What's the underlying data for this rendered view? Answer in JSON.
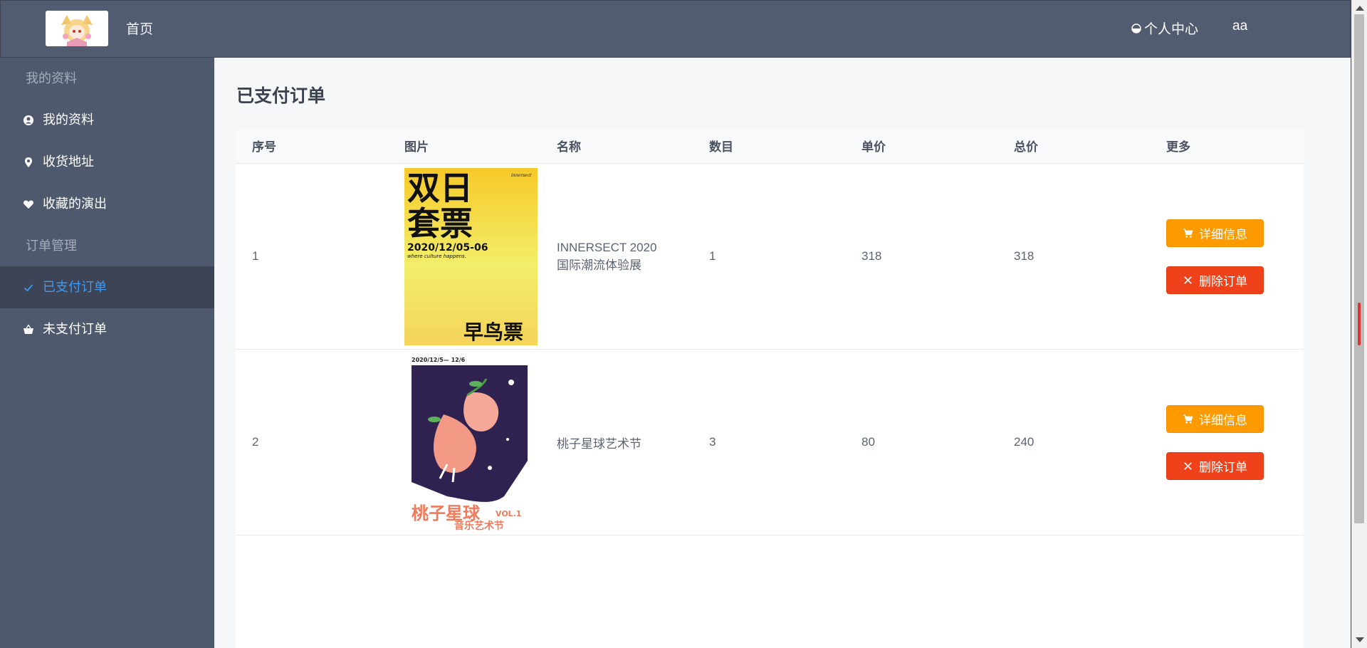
{
  "header": {
    "home_label": "首页",
    "center_label": "个人中心",
    "user_label": "aa"
  },
  "sidebar": {
    "group1": "我的资料",
    "items_group1": [
      {
        "label": "我的资料",
        "icon": "user-circle-icon"
      },
      {
        "label": "收货地址",
        "icon": "location-pin-icon"
      },
      {
        "label": "收藏的演出",
        "icon": "heart-icon"
      }
    ],
    "group2": "订单管理",
    "items_group2": [
      {
        "label": "已支付订单",
        "icon": "check-icon",
        "active": true
      },
      {
        "label": "未支付订单",
        "icon": "basket-icon"
      }
    ]
  },
  "main": {
    "title": "已支付订单",
    "columns": [
      "序号",
      "图片",
      "名称",
      "数目",
      "单价",
      "总价",
      "更多"
    ],
    "rows": [
      {
        "index": "1",
        "poster": {
          "line1": "双日",
          "line2": "套票",
          "date": "2020/12/05-06",
          "tagline": "where culture happens.",
          "badge": "早鸟票",
          "brand": "innersect"
        },
        "name": "INNERSECT 2020国际潮流体验展",
        "count": "1",
        "price": "318",
        "total": "318"
      },
      {
        "index": "2",
        "poster": {
          "date": "2020/12/5— 12/6",
          "title": "桃子星球",
          "vol": "VOL.1",
          "subtitle": "音乐艺术节"
        },
        "name": "桃子星球艺术节",
        "count": "3",
        "price": "80",
        "total": "240"
      }
    ],
    "detail_label": "详细信息",
    "delete_label": "删除订单"
  },
  "colors": {
    "header_bg": "#525c71",
    "sidebar_bg": "#4f596e",
    "active_text": "#3c9bf5",
    "detail_btn": "#fd9a00",
    "delete_btn": "#f0421a"
  }
}
